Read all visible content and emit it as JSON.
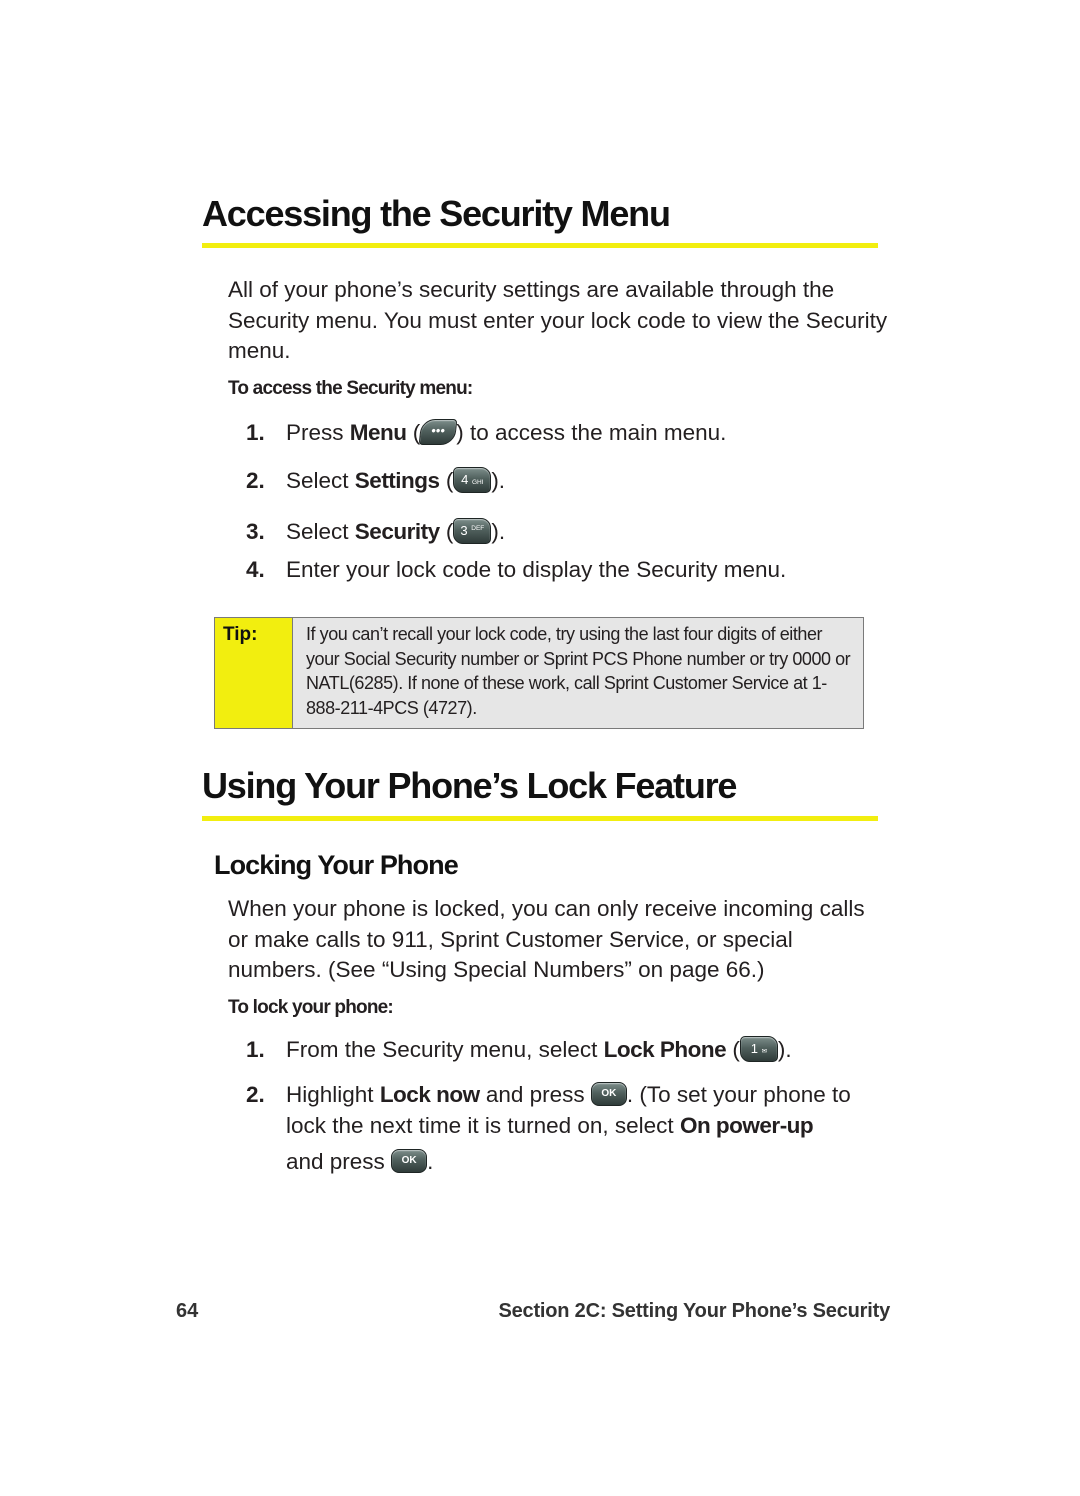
{
  "section1": {
    "title": "Accessing the Security Menu",
    "intro": "All of your phone’s security settings are available through the Security menu. You must enter your lock code to view the Security menu.",
    "subhead": "To access the Security menu:",
    "steps": [
      {
        "num": "1.",
        "pre": "Press ",
        "bold": "Menu",
        "mid": " (",
        "key": "•••",
        "post": ") to access the main menu."
      },
      {
        "num": "2.",
        "pre": "Select ",
        "bold": "Settings",
        "mid": " (",
        "key_main": "4",
        "key_sub": "GHI",
        "post": ")."
      },
      {
        "num": "3.",
        "pre": "Select ",
        "bold": "Security",
        "mid": " (",
        "key_main": "3",
        "key_sub": "DEF",
        "post": ")."
      },
      {
        "num": "4.",
        "text": "Enter your lock code to display the Security menu."
      }
    ]
  },
  "tip": {
    "label": "Tip:",
    "text": "If you can’t recall your lock code, try using the last four digits of either your Social Security number or Sprint PCS Phone number or try 0000 or NATL(6285). If none of these work, call Sprint Customer Service at 1-888-211-4PCS (4727).",
    "colors": {
      "label_bg": "#f2ee0f",
      "box_bg": "#e6e6e6",
      "border": "#7a7a7a"
    }
  },
  "section2": {
    "title": "Using Your Phone’s Lock Feature",
    "subsection_title": "Locking Your Phone",
    "intro": "When your phone is locked, you can only receive incoming calls or make calls to 911, Sprint Customer Service, or special numbers. (See “Using Special Numbers” on page 66.)",
    "subhead": "To lock your phone:",
    "steps": [
      {
        "num": "1.",
        "pre": "From the Security menu, select ",
        "bold": "Lock Phone",
        "mid": " (",
        "key_main": "1",
        "key_sub": "✉",
        "post": ")."
      },
      {
        "num": "2.",
        "pre": "Highlight ",
        "bold": "Lock now",
        "mid": " and press ",
        "key": "OK",
        "post": ". (To set your phone to",
        "line2_pre": "lock the next time it is turned on, select ",
        "line2_bold": "On power-up",
        "line3_pre": "and press ",
        "line3_key": "OK",
        "line3_post": "."
      }
    ]
  },
  "footer": {
    "page_number": "64",
    "section_title": "Section 2C: Setting Your Phone’s Security"
  },
  "accent_color": "#f2ee0f"
}
